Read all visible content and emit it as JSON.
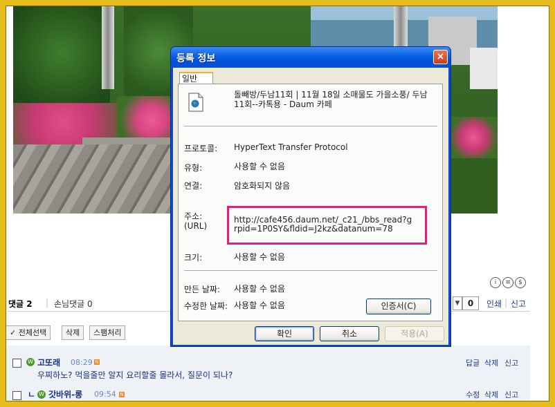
{
  "dialog": {
    "title": "등록 정보",
    "close_glyph": "×",
    "tab_label": "일반",
    "doc_title": "돌빼방/두남11회 | 11월 18일 소매물도 가을소풍/ 두남11회--카톡용 - Daum 카페",
    "labels": {
      "protocol": "프로토콜:",
      "type": "유형:",
      "connection": "연결:",
      "address": "주소:",
      "address_sub": "(URL)",
      "size": "크기:",
      "created": "만든 날짜:",
      "modified": "수정한 날짜:"
    },
    "values": {
      "protocol": "HyperText Transfer Protocol",
      "type": "사용할 수 없음",
      "connection": "암호화되지 않음",
      "address": "http://cafe456.daum.net/_c21_/bbs_read?grpid=1P0SY&fldid=J2kz&datanum=78",
      "size": "사용할 수 없음",
      "created": "사용할 수 없음",
      "modified": "사용할 수 없음"
    },
    "cert_button": "인증서(C)",
    "ok_button": "확인",
    "cancel_button": "취소",
    "apply_button": "적용(A)",
    "highlight_color": "#e0207a"
  },
  "page": {
    "share_icons": [
      "i",
      "≡",
      "$"
    ],
    "comment_tab": "댓글 2",
    "guest_tab": "손님댓글 0",
    "separator": "|",
    "select_arrow": "▼",
    "count": "0",
    "print": "인쇄",
    "report": "신고",
    "select_all": "✓ 전체선택",
    "delete": "삭제",
    "spam": "스팸처리",
    "comments": [
      {
        "level": "W",
        "nick": "고또래",
        "time": "08:29",
        "new": "N",
        "text": "우찌하노? 먹을줄만 알지 요리할줄 몰라서, 질문이 되나?",
        "actions": [
          "답글",
          "삭제",
          "신고"
        ]
      },
      {
        "reply_mark": "ㄴ",
        "level": "W",
        "nick": "갓바위-롱",
        "time": "09:54",
        "new": "N",
        "actions": [
          "수정",
          "삭제",
          "신고"
        ]
      }
    ]
  }
}
